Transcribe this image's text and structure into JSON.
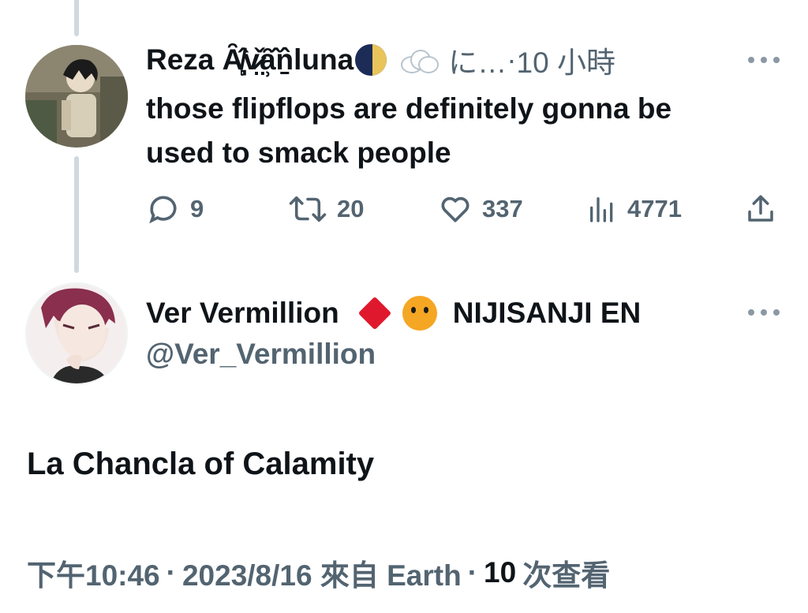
{
  "reply": {
    "author_name": "Reza Ȃ̸̹̻̂v̷̤̌ȃ̹̂ṉ̂luna",
    "moon_icon": "waning-moon-icon",
    "cloud_icon": "cloud-icon",
    "author_handle": "に…",
    "time_sep": "·",
    "time": "10 小時",
    "text": "those flipflops are definitely gonna be used to smack people",
    "actions": {
      "replies": "9",
      "retweets": "20",
      "likes": "337",
      "views": "4771"
    }
  },
  "tweet": {
    "author_name": "Ver Vermillion",
    "diamond_icon": "red-diamond-icon",
    "tiger_icon": "tiger-face-icon",
    "author_org": "NIJISANJI EN",
    "author_handle": "@Ver_Vermillion",
    "text": "La Chancla of Calamity",
    "time": "下午10:46",
    "sep1": "·",
    "date": "2023/8/16 來自 Earth",
    "sep2": "·",
    "views_count": "10",
    "views_label": "次查看"
  },
  "colors": {
    "text_primary": "#0f1419",
    "text_secondary": "#536471",
    "thread_line": "#cfd9de",
    "diamond": "#e0182d"
  }
}
